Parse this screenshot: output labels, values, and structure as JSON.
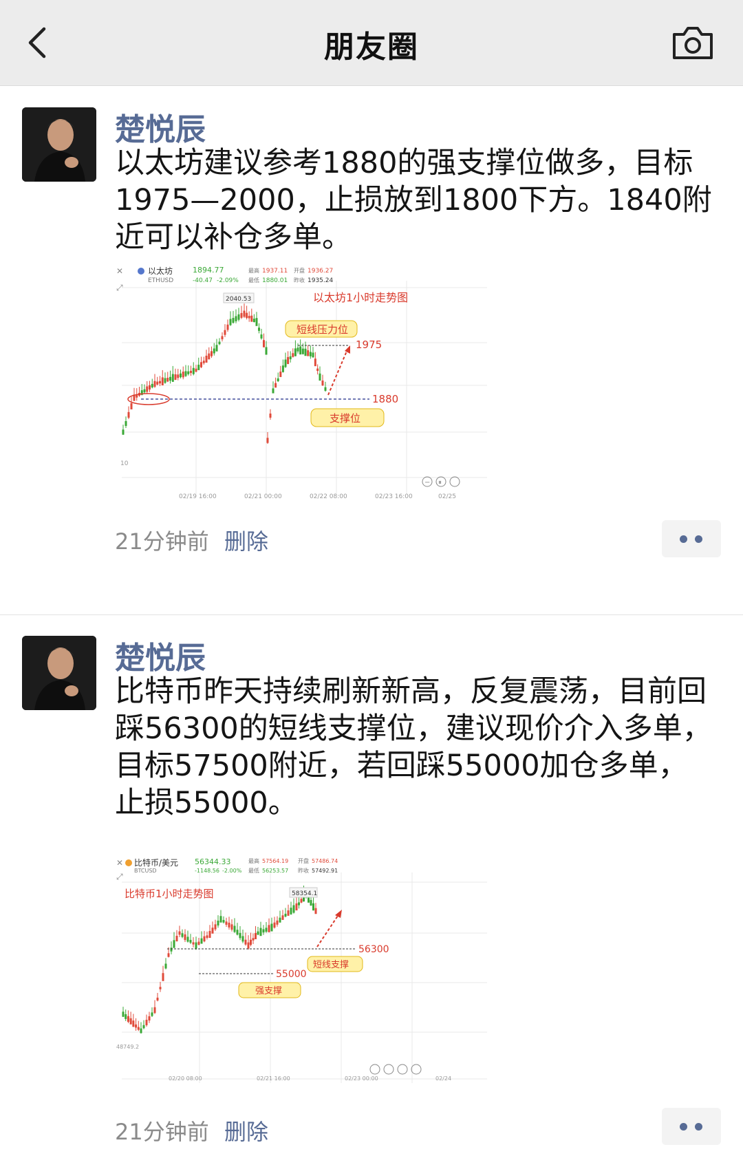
{
  "header": {
    "title": "朋友圈"
  },
  "posts": [
    {
      "author": "楚悦辰",
      "text": "以太坊建议参考1880的强支撑位做多，目标1975—2000，止损放到1800下方。1840附近可以补仓多单。",
      "time": "21分钟前",
      "delete": "删除",
      "chart": {
        "symbol": "以太坊",
        "code": "ETHUSD",
        "price": "1894.77",
        "change": "-40.47",
        "change_pct": "-2.09%",
        "high_label": "最高",
        "high": "1937.11",
        "low_label": "最低",
        "low": "1880.01",
        "open_label": "开盘",
        "open": "1936.27",
        "prev_label": "昨收",
        "prev": "1935.24",
        "caption": "以太坊1小时走势图",
        "peak_label": "2040.53",
        "resistance_tag": "短线压力位",
        "resistance_value": "1975",
        "support_tag": "支撑位",
        "support_value": "1880",
        "x_ticks": [
          "02/19 16:00",
          "02/21 00:00",
          "02/22 08:00",
          "02/23 16:00",
          "02/25"
        ],
        "y_tick": "10"
      }
    },
    {
      "author": "楚悦辰",
      "text": "比特币昨天持续刷新新高，反复震荡，目前回踩56300的短线支撑位，建议现价介入多单，目标57500附近，若回踩55000加仓多单，止损55000。",
      "time": "21分钟前",
      "delete": "删除",
      "chart": {
        "symbol": "比特币/美元",
        "code": "BTCUSD",
        "price": "56344.33",
        "change": "-1148.56",
        "change_pct": "-2.00%",
        "high_label": "最高",
        "high": "57564.19",
        "low_label": "最低",
        "low": "56253.57",
        "open_label": "开盘",
        "open": "57486.74",
        "prev_label": "昨收",
        "prev": "57492.91",
        "caption": "比特币1小时走势图",
        "peak_label": "58354.1",
        "support_value": "56300",
        "short_support_tag": "短线支撑",
        "strong_value": "55000",
        "strong_tag": "强支撑",
        "low_tick": "48749.2",
        "x_ticks": [
          "02/20 08:00",
          "02/21 16:00",
          "02/23 00:00",
          "02/24"
        ]
      }
    }
  ],
  "colors": {
    "link": "#576b95",
    "up": "#3aa836",
    "down": "#e04a3a",
    "annot": "#d93a2c",
    "tag": "#fff1a8"
  },
  "icons": [
    "back-arrow-icon",
    "camera-icon",
    "more-dots-icon"
  ]
}
